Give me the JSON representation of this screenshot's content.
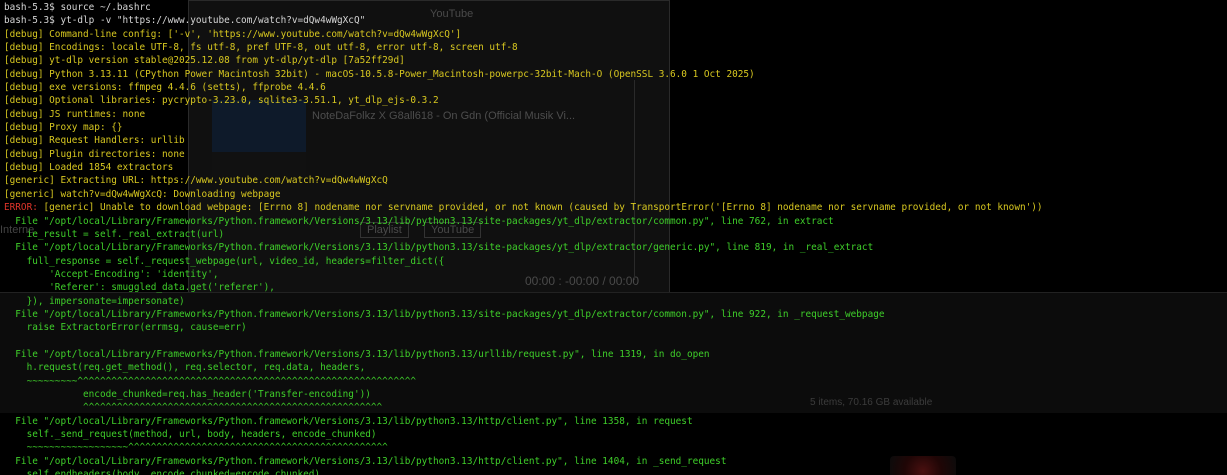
{
  "background_window": {
    "title": "YouTube",
    "video_title": "NoteDaFolkz X G8all618 - On Gdn (Official Musik Vi...",
    "tab_playlist": "Playlist",
    "tab_youtube": "YouTube",
    "internet_label": "Interne",
    "time_display": "00:00 : -00:00 / 00:00",
    "status": "5 items, 70.16 GB available"
  },
  "terminal": {
    "lines": [
      {
        "color": "white",
        "text": "bash-5.3$ source ~/.bashrc"
      },
      {
        "color": "white",
        "text": "bash-5.3$ yt-dlp -v \"https://www.youtube.com/watch?v=dQw4wWgXcQ\""
      },
      {
        "color": "yellow",
        "text": "[debug] Command-line config: ['-v', 'https://www.youtube.com/watch?v=dQw4wWgXcQ']"
      },
      {
        "color": "yellow",
        "text": "[debug] Encodings: locale UTF-8, fs utf-8, pref UTF-8, out utf-8, error utf-8, screen utf-8"
      },
      {
        "color": "yellow",
        "text": "[debug] yt-dlp version stable@2025.12.08 from yt-dlp/yt-dlp [7a52ff29d]"
      },
      {
        "color": "yellow",
        "text": "[debug] Python 3.13.11 (CPython Power Macintosh 32bit) - macOS-10.5.8-Power_Macintosh-powerpc-32bit-Mach-O (OpenSSL 3.6.0 1 Oct 2025)"
      },
      {
        "color": "yellow",
        "text": "[debug] exe versions: ffmpeg 4.4.6 (setts), ffprobe 4.4.6"
      },
      {
        "color": "yellow",
        "text": "[debug] Optional libraries: pycrypto-3.23.0, sqlite3-3.51.1, yt_dlp_ejs-0.3.2"
      },
      {
        "color": "yellow",
        "text": "[debug] JS runtimes: none"
      },
      {
        "color": "yellow",
        "text": "[debug] Proxy map: {}"
      },
      {
        "color": "yellow",
        "text": "[debug] Request Handlers: urllib"
      },
      {
        "color": "yellow",
        "text": "[debug] Plugin directories: none"
      },
      {
        "color": "yellow",
        "text": "[debug] Loaded 1854 extractors"
      },
      {
        "color": "yellow",
        "text": "[generic] Extracting URL: https://www.youtube.com/watch?v=dQw4wWgXcQ"
      },
      {
        "color": "yellow",
        "text": "[generic] watch?v=dQw4wWgXcQ: Downloading webpage"
      },
      {
        "color": "yellow",
        "prefix": "ERROR:",
        "text": " [generic] Unable to download webpage: [Errno 8] nodename nor servname provided, or not known (caused by TransportError('[Errno 8] nodename nor servname provided, or not known'))"
      },
      {
        "color": "green",
        "text": "  File \"/opt/local/Library/Frameworks/Python.framework/Versions/3.13/lib/python3.13/site-packages/yt_dlp/extractor/common.py\", line 762, in extract"
      },
      {
        "color": "green",
        "text": "    ie_result = self._real_extract(url)"
      },
      {
        "color": "green",
        "text": "  File \"/opt/local/Library/Frameworks/Python.framework/Versions/3.13/lib/python3.13/site-packages/yt_dlp/extractor/generic.py\", line 819, in _real_extract"
      },
      {
        "color": "green",
        "text": "    full_response = self._request_webpage(url, video_id, headers=filter_dict({"
      },
      {
        "color": "green",
        "text": "        'Accept-Encoding': 'identity',"
      },
      {
        "color": "green",
        "text": "        'Referer': smuggled_data.get('referer'),"
      },
      {
        "color": "green",
        "text": "    }), impersonate=impersonate)"
      },
      {
        "color": "green",
        "text": "  File \"/opt/local/Library/Frameworks/Python.framework/Versions/3.13/lib/python3.13/site-packages/yt_dlp/extractor/common.py\", line 922, in _request_webpage"
      },
      {
        "color": "green",
        "text": "    raise ExtractorError(errmsg, cause=err)"
      },
      {
        "color": "green",
        "text": ""
      },
      {
        "color": "green",
        "text": "  File \"/opt/local/Library/Frameworks/Python.framework/Versions/3.13/lib/python3.13/urllib/request.py\", line 1319, in do_open"
      },
      {
        "color": "green",
        "text": "    h.request(req.get_method(), req.selector, req.data, headers,"
      },
      {
        "color": "green",
        "text": "    ~~~~~~~~~^^^^^^^^^^^^^^^^^^^^^^^^^^^^^^^^^^^^^^^^^^^^^^^^^^^^^^^^^^^^"
      },
      {
        "color": "green",
        "text": "              encode_chunked=req.has_header('Transfer-encoding'))"
      },
      {
        "color": "green",
        "text": "              ^^^^^^^^^^^^^^^^^^^^^^^^^^^^^^^^^^^^^^^^^^^^^^^^^^^^^"
      },
      {
        "color": "green",
        "text": "  File \"/opt/local/Library/Frameworks/Python.framework/Versions/3.13/lib/python3.13/http/client.py\", line 1358, in request"
      },
      {
        "color": "green",
        "text": "    self._send_request(method, url, body, headers, encode_chunked)"
      },
      {
        "color": "green",
        "text": "    ~~~~~~~~~~~~~~~~~~^^^^^^^^^^^^^^^^^^^^^^^^^^^^^^^^^^^^^^^^^^^^^^"
      },
      {
        "color": "green",
        "text": "  File \"/opt/local/Library/Frameworks/Python.framework/Versions/3.13/lib/python3.13/http/client.py\", line 1404, in _send_request"
      },
      {
        "color": "green",
        "text": "    self.endheaders(body, encode_chunked=encode_chunked)"
      }
    ]
  },
  "colors": {
    "background": "#000000",
    "prompt": "#d6d6d6",
    "debug": "#d8c820",
    "traceback": "#3fcf2a",
    "error": "#e0352a"
  }
}
